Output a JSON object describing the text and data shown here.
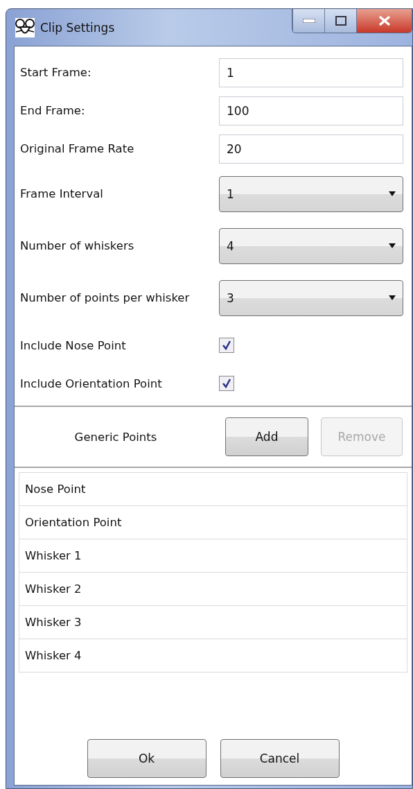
{
  "window": {
    "title": "Clip Settings"
  },
  "settings": [
    {
      "kind": "text",
      "label": "Start Frame:",
      "value": "1"
    },
    {
      "kind": "text",
      "label": "End Frame:",
      "value": "100"
    },
    {
      "kind": "text",
      "label": "Original Frame Rate",
      "value": "20"
    },
    {
      "kind": "dropdown",
      "label": "Frame Interval",
      "value": "1"
    },
    {
      "kind": "dropdown",
      "label": "Number of whiskers",
      "value": "4"
    },
    {
      "kind": "dropdown",
      "label": "Number of points per whisker",
      "value": "3"
    },
    {
      "kind": "checkbox",
      "label": "Include Nose Point",
      "checked": true
    },
    {
      "kind": "checkbox",
      "label": "Include Orientation Point",
      "checked": true
    }
  ],
  "generic_points": {
    "label": "Generic Points",
    "buttons": [
      {
        "label": "Add",
        "disabled": false
      },
      {
        "label": "Remove",
        "disabled": true
      }
    ]
  },
  "points_list": [
    "Nose Point",
    "Orientation Point",
    "Whisker 1",
    "Whisker 2",
    "Whisker 3",
    "Whisker 4"
  ],
  "footer_buttons": [
    "Ok",
    "Cancel"
  ]
}
